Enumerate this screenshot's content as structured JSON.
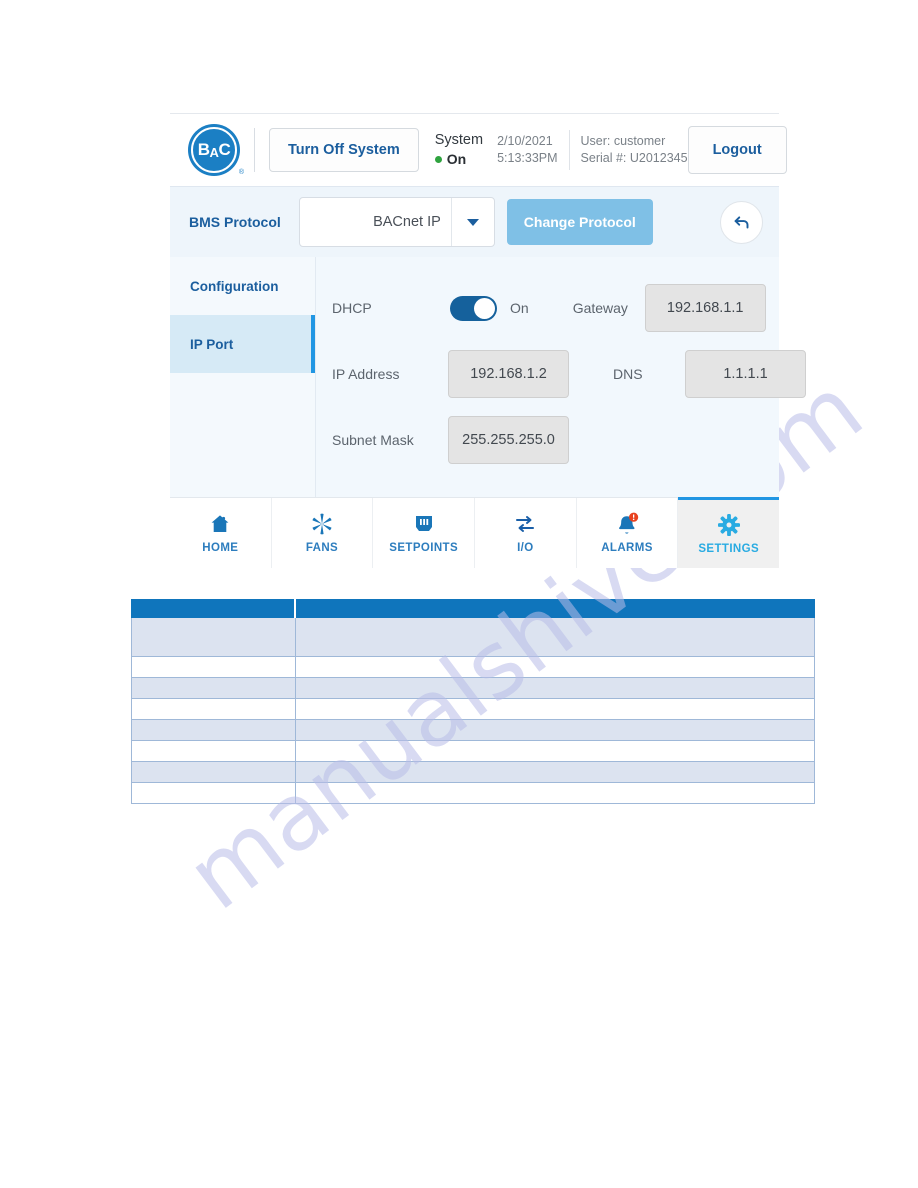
{
  "device": {
    "header": {
      "logo_text_b": "B",
      "logo_text_a": "A",
      "logo_text_c": "C",
      "logo_registered": "®",
      "power_button": "Turn Off System",
      "system_label": "System",
      "system_state": "On",
      "date": "2/10/2021",
      "time": "5:13:33PM",
      "user": "User: customer",
      "serial": "Serial #: U2012345",
      "logout": "Logout"
    },
    "protocol": {
      "label": "BMS Protocol",
      "selected": "BACnet IP",
      "change_button": "Change Protocol",
      "undo_icon": "undo-arrow-icon",
      "caret_icon": "chevron-down-icon"
    },
    "sidebar": {
      "items": [
        {
          "label": "Configuration",
          "active": false
        },
        {
          "label": "IP Port",
          "active": true
        }
      ]
    },
    "form": {
      "dhcp_label": "DHCP",
      "dhcp_state": "On",
      "gateway_label": "Gateway",
      "gateway_value": "192.168.1.1",
      "ip_label": "IP Address",
      "ip_value": "192.168.1.2",
      "dns_label": "DNS",
      "dns_value": "1.1.1.1",
      "subnet_label": "Subnet Mask",
      "subnet_value": "255.255.255.0"
    },
    "tabs": [
      {
        "label": "HOME",
        "icon": "home-icon",
        "active": false
      },
      {
        "label": "FANS",
        "icon": "fan-icon",
        "active": false
      },
      {
        "label": "SETPOINTS",
        "icon": "sliders-icon",
        "active": false
      },
      {
        "label": "I/O",
        "icon": "arrows-exchange-icon",
        "active": false
      },
      {
        "label": "ALARMS",
        "icon": "bell-alert-icon",
        "active": false
      },
      {
        "label": "SETTINGS",
        "icon": "gear-icon",
        "active": true
      }
    ]
  },
  "table": {
    "rows": [
      {
        "type": "head",
        "c1": "",
        "c2": ""
      },
      {
        "type": "tall",
        "shade": true,
        "c1": "",
        "c2": ""
      },
      {
        "type": "norm",
        "shade": false,
        "c1": "",
        "c2": ""
      },
      {
        "type": "norm",
        "shade": true,
        "c1": "",
        "c2": ""
      },
      {
        "type": "norm",
        "shade": false,
        "c1": "",
        "c2": ""
      },
      {
        "type": "norm",
        "shade": true,
        "c1": "",
        "c2": ""
      },
      {
        "type": "norm",
        "shade": false,
        "c1": "",
        "c2": ""
      },
      {
        "type": "norm",
        "shade": true,
        "c1": "",
        "c2": ""
      },
      {
        "type": "norm",
        "shade": false,
        "c1": "",
        "c2": ""
      }
    ]
  },
  "watermark": {
    "text": "manualshive.com"
  },
  "colors": {
    "brand_blue": "#1b7fc4",
    "dark_blue": "#1b5e9e",
    "accent_blue": "#2196e3",
    "light_blue_button": "#7fc0e6",
    "panel_bg": "#eef5fb",
    "alarm_red": "#e8411f",
    "status_green": "#2fa33f",
    "table_header": "#0f75bc"
  }
}
